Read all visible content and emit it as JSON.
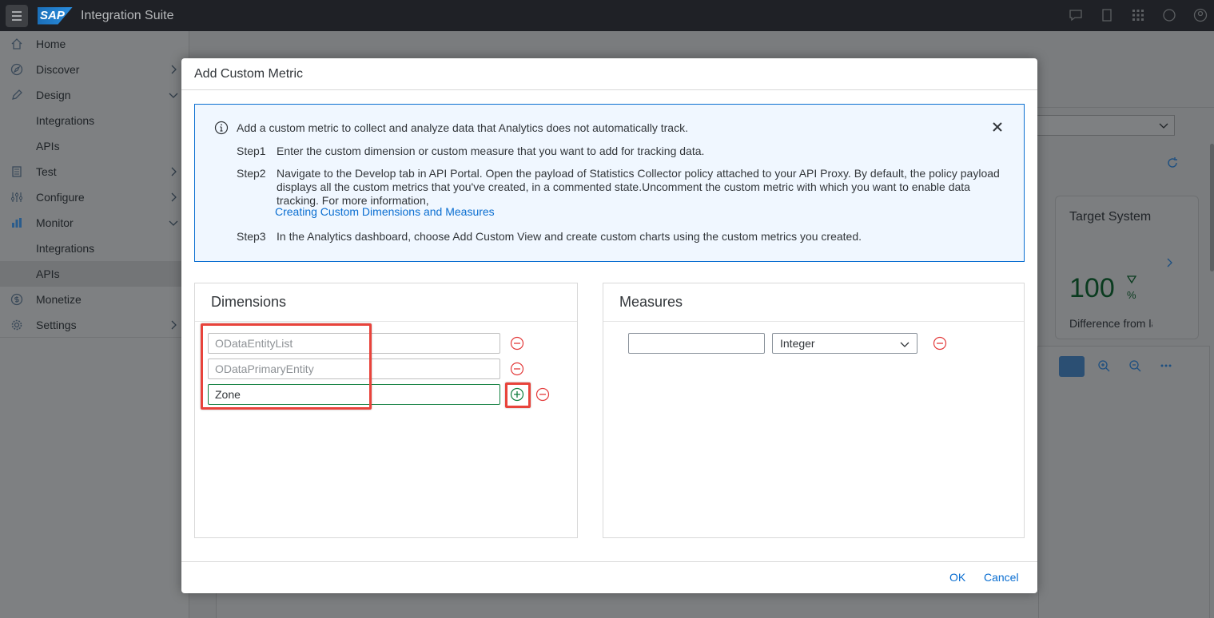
{
  "shell": {
    "logo": "SAP",
    "title": "Integration Suite"
  },
  "sidebar": {
    "items": [
      {
        "label": "Home",
        "icon": "home-icon"
      },
      {
        "label": "Discover",
        "icon": "compass-icon"
      },
      {
        "label": "Design",
        "icon": "pencil-icon"
      },
      {
        "label": "Integrations"
      },
      {
        "label": "APIs"
      },
      {
        "label": "Test",
        "icon": "test-icon"
      },
      {
        "label": "Configure",
        "icon": "sliders-icon"
      },
      {
        "label": "Monitor",
        "icon": "bar-chart-icon"
      },
      {
        "label": "Integrations"
      },
      {
        "label": "APIs"
      },
      {
        "label": "Monetize",
        "icon": "dollar-icon"
      },
      {
        "label": "Settings",
        "icon": "gear-icon"
      }
    ]
  },
  "background": {
    "card_title": "Target System",
    "card_value": "100",
    "card_unit": "%",
    "card_caption": "Difference from la"
  },
  "dialog": {
    "title": "Add Custom Metric",
    "info": {
      "intro": "Add a custom metric to collect and analyze data that Analytics does not automatically track.",
      "steps": [
        {
          "label": "Step1",
          "text": "Enter the custom dimension or custom measure that you want to add for tracking data."
        },
        {
          "label": "Step2",
          "text": "Navigate to the Develop tab in API Portal. Open the payload of Statistics Collector policy attached to your API Proxy. By default, the policy payload displays all the custom metrics that you've created, in a commented state.Uncomment the custom metric with which you want to enable data tracking. For more information,"
        },
        {
          "label": "Step3",
          "text": "In the Analytics dashboard, choose Add Custom View and create custom charts using the custom metrics you created."
        }
      ],
      "link": "Creating Custom Dimensions and Measures"
    },
    "dimensions": {
      "title": "Dimensions",
      "fields": [
        {
          "value": "",
          "placeholder": "ODataEntityList"
        },
        {
          "value": "",
          "placeholder": "ODataPrimaryEntity"
        },
        {
          "value": "Zone",
          "placeholder": ""
        }
      ]
    },
    "measures": {
      "title": "Measures",
      "name_value": "",
      "type_selected": "Integer"
    },
    "ok_label": "OK",
    "cancel_label": "Cancel"
  },
  "colors": {
    "brand_blue": "#0a6ed1",
    "add_green": "#107e3e",
    "remove_red": "#e33b3b",
    "highlight_red": "#e8433b"
  }
}
